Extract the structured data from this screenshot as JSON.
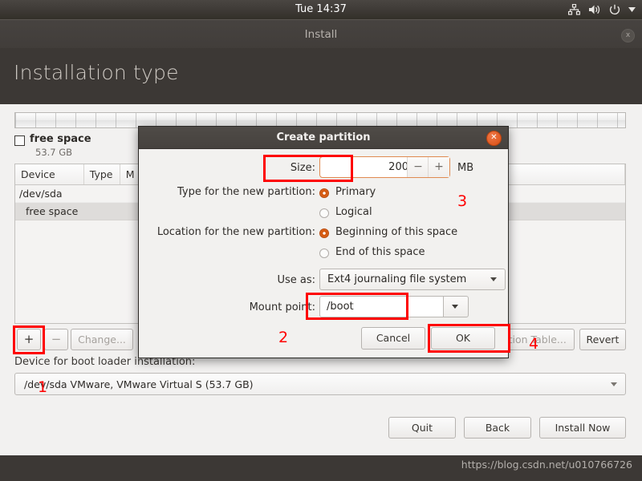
{
  "panel": {
    "clock": "Tue 14:37",
    "icons": [
      "network-icon",
      "volume-icon",
      "power-icon",
      "chevron-down-icon"
    ]
  },
  "window": {
    "title": "Install",
    "close_label": "x"
  },
  "page": {
    "title": "Installation type"
  },
  "legend": {
    "label": "free space",
    "size": "53.7 GB"
  },
  "table": {
    "columns": [
      "Device",
      "Type",
      "M"
    ],
    "rows": [
      {
        "device": "/dev/sda",
        "type": "",
        "mount": ""
      },
      {
        "device": "free space",
        "type": "",
        "mount": ""
      }
    ]
  },
  "toolbar": {
    "add_label": "+",
    "remove_label": "−",
    "change_label": "Change...",
    "new_table_label": "ition Table...",
    "revert_label": "Revert"
  },
  "bootloader": {
    "label": "Device for boot loader installation:",
    "value": "/dev/sda VMware, VMware Virtual S (53.7 GB)"
  },
  "nav": {
    "quit_label": "Quit",
    "back_label": "Back",
    "install_label": "Install Now"
  },
  "dialog": {
    "title": "Create partition",
    "close_label": "✕",
    "size_label": "Size:",
    "size_value": "200",
    "size_minus": "−",
    "size_plus": "+",
    "size_unit": "MB",
    "type_label": "Type for the new partition:",
    "type_options": [
      "Primary",
      "Logical"
    ],
    "type_selected": "Primary",
    "location_label": "Location for the new partition:",
    "location_options": [
      "Beginning of this space",
      "End of this space"
    ],
    "location_selected": "Beginning of this space",
    "use_as_label": "Use as:",
    "use_as_value": "Ext4 journaling file system",
    "mount_point_label": "Mount point:",
    "mount_point_value": "/boot",
    "cancel_label": "Cancel",
    "ok_label": "OK"
  },
  "annotations": {
    "step1": "1",
    "step2": "2",
    "step3": "3",
    "step4": "4",
    "color": "#fe0000"
  },
  "footer": {
    "watermark": "https://blog.csdn.net/u010766726"
  }
}
